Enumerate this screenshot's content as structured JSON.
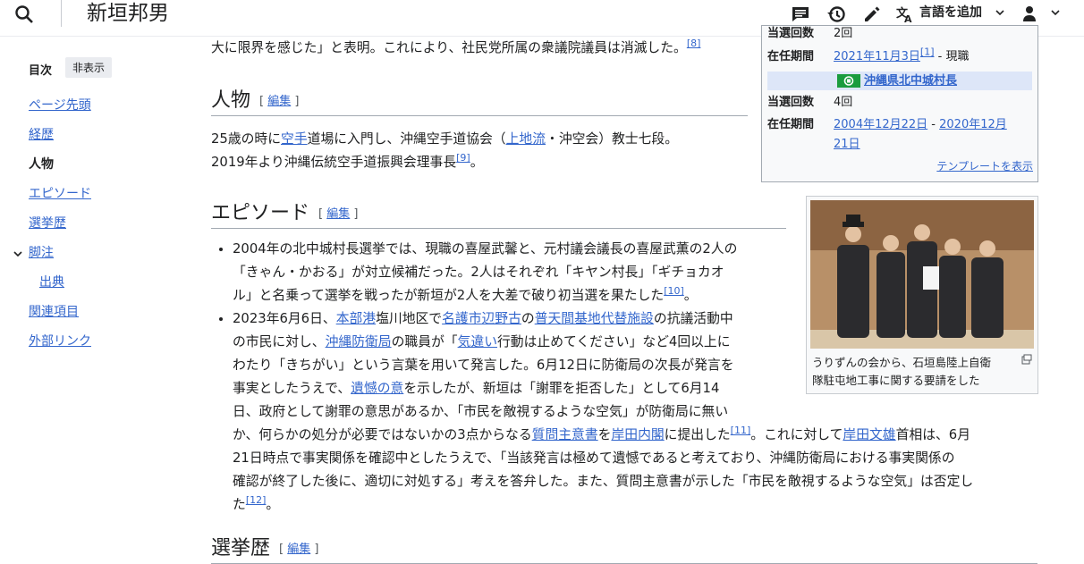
{
  "header": {
    "title": "新垣邦男",
    "add_language": "言語を追加"
  },
  "toc": {
    "title": "目次",
    "hide_label": "非表示",
    "items": [
      {
        "label": "ページ先頭"
      },
      {
        "label": "経歴"
      },
      {
        "label": "人物"
      },
      {
        "label": "エピソード"
      },
      {
        "label": "選挙歴"
      },
      {
        "label": "脚注"
      },
      {
        "label": "出典"
      },
      {
        "label": "関連項目"
      },
      {
        "label": "外部リンク"
      }
    ]
  },
  "infobox": {
    "row0_label": "当選回数",
    "row0_value": "2回",
    "row1_label": "在任期間",
    "row1_date": "2021年11月3日",
    "row1_ref": "[1]",
    "row1_rest": " - 現職",
    "office": "沖縄県北中城村長",
    "row2_label": "当選回数",
    "row2_value": "4回",
    "row3_label": "在任期間",
    "row3_date1": "2004年12月22日",
    "row3_sep": " - ",
    "row3_date2a": "2020年12月",
    "row3_date2b": "21日",
    "template_link": "テンプレートを表示",
    "color_village": "#1a9c3e"
  },
  "image": {
    "caption_line1": "うりずんの会から、石垣島陸上自衛",
    "caption_line2": "隊駐屯地工事に関する要請をした"
  },
  "top_para": {
    "text": "大に限界を感じた」と表明。これにより、社民党所属の衆議院議員は消滅した。",
    "ref": "[8]"
  },
  "section_person": {
    "heading": "人物",
    "edit_label": "編集",
    "t1": "25歳の時に",
    "l1": "空手",
    "t2": "道場に入門し、沖縄空手道協会（",
    "l2": "上地流",
    "t3": "・沖空会）教士七段。",
    "t4": "2019年より沖縄伝統空手道振興会理事長",
    "ref": "[9]",
    "t5": "。"
  },
  "section_episode": {
    "heading": "エピソード",
    "edit_label": "編集",
    "b1_line1": "2004年の北中城村長選挙では、現職の喜屋武馨と、元村議会議長の喜屋武薫の2人の",
    "b1_line2": "「きゃん・かおる」が対立候補だった。2人はそれぞれ「キヤン村長」「ギチョカオ",
    "b1_line3": "ル」と名乗って選挙を戦ったが新垣が2人を大差で破り初当選を果たした",
    "b1_ref": "[10]",
    "b1_end": "。",
    "b2_t1": "2023年6月6日、",
    "b2_l1": "本部港",
    "b2_t2": "塩川地区で",
    "b2_l2": "名護市辺野古",
    "b2_t3": "の",
    "b2_l3": "普天間基地代替施設",
    "b2_t4": "の抗議活動中",
    "b2_t5": "の市民に対し、",
    "b2_l4": "沖縄防衛局",
    "b2_t6": "の職員が「",
    "b2_l5": "気違い",
    "b2_t7": "行動は止めてください」など4回以上に",
    "b2_t8": "わたり「きちがい」という言葉を用いて発言した。6月12日に防衛局の次長が発言を",
    "b2_t9": "事実としたうえで、",
    "b2_l6": "遺憾の意",
    "b2_t10": "を示したが、新垣は「謝罪を拒否した」として6月14",
    "b2_t11": "日、政府として謝罪の意思があるか、「市民を敵視するような空気」が防衛局に無い",
    "b2_t12": "か、何らかの処分が必要ではないかの3点からなる",
    "b2_l7": "質問主意書",
    "b2_t13": "を",
    "b2_l8": "岸田内閣",
    "b2_t14": "に提出した",
    "b2_ref1": "[11]",
    "b2_t15": "。これに対して",
    "b2_l9": "岸田文雄",
    "b2_t16": "首相は、6月",
    "b2_t17": "21日時点で事実関係を確認中としたうえで、「当該発言は極めて遺憾であると考えており、沖縄防衛局における事実関係の",
    "b2_t18": "確認が終了した後に、適切に対処する」考えを答弁した。また、質問主意書が示した「市民を敵視するような空気」は否定し",
    "b2_t19": "た",
    "b2_ref2": "[12]",
    "b2_t20": "。"
  },
  "section_election": {
    "heading": "選挙歴",
    "edit_label": "編集"
  }
}
